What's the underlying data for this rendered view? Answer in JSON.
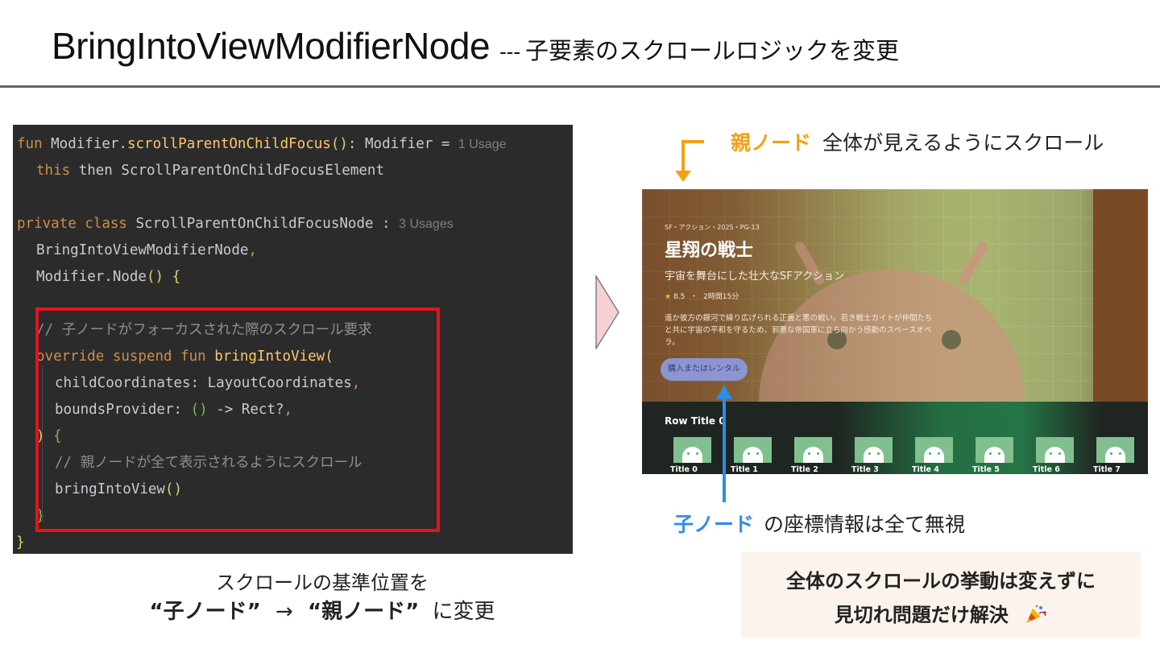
{
  "slide": {
    "title_main": "BringIntoViewModifierNode",
    "title_sep": "---",
    "title_sub": "子要素のスクロールロジックを変更"
  },
  "code": {
    "l1_kw": "fun",
    "l1_recv": " Modifier.",
    "l1_fn": "scrollParentOnChildFocus",
    "l1_paren": "()",
    "l1_rest": ": Modifier = ",
    "l1_hint": "1 Usage",
    "l2_kw": "this",
    "l2_rest": " then ScrollParentOnChildFocusElement",
    "l3_kw": "private class",
    "l3_rest": " ScrollParentOnChildFocusNode : ",
    "l3_hint": "3 Usages",
    "l4": "BringIntoViewModifierNode",
    "l4_comma": ",",
    "l5": "Modifier.Node",
    "l5_paren": "()",
    "l5_brace": " {",
    "c1": "// 子ノードがフォーカスされた際のスクロール要求",
    "l7_kw": "override suspend fun",
    "l7_fn": " bringIntoView",
    "l7_paren": "(",
    "l8": "childCoordinates: LayoutCoordinates",
    "l8_comma": ",",
    "l9_a": "boundsProvider: ",
    "l9_b": "()",
    "l9_c": " -> Rect?",
    "l9_comma": ",",
    "l10_a": ")",
    "l10_b": " {",
    "c2": "// 親ノードが全て表示されるようにスクロール",
    "l12": "bringIntoView",
    "l12_paren": "()",
    "l13": "}",
    "l14": "}"
  },
  "caption": {
    "line1": "スクロールの基準位置を",
    "child_quoted": "“子ノード”",
    "arrow": "→",
    "parent_quoted": "“親ノード”",
    "suffix": "に変更"
  },
  "annotations": {
    "parent_node": "親ノード",
    "parent_text": "全体が見えるようにスクロール",
    "child_node": "子ノード",
    "child_text": "の座標情報は全て無視",
    "parent_color": "#f2a114",
    "child_color": "#2f8de5"
  },
  "tv": {
    "meta": "SF・アクション・2025・PG-13",
    "title": "星翔の戦士",
    "tagline": "宇宙を舞台にした壮大なSFアクション",
    "rating_star": "★",
    "rating": "8.5",
    "dot": "・",
    "duration": "2時間15分",
    "description": "遥か彼方の銀河で繰り広げられる正義と悪の戦い。若き戦士カイトが仲間たちと共に宇宙の平和を守るため、邪悪な帝国軍に立ち向かう感動のスペースオペラ。",
    "button": "購入またはレンタル",
    "row_title": "Row Title 0",
    "cards": [
      "Title 0",
      "Title 1",
      "Title 2",
      "Title 3",
      "Title 4",
      "Title 5",
      "Title 6",
      "Title 7"
    ]
  },
  "result": {
    "line1": "全体のスクロールの挙動は変えずに",
    "line2": "見切れ問題だけ解決",
    "emoji_icon": "party-popper-icon"
  }
}
